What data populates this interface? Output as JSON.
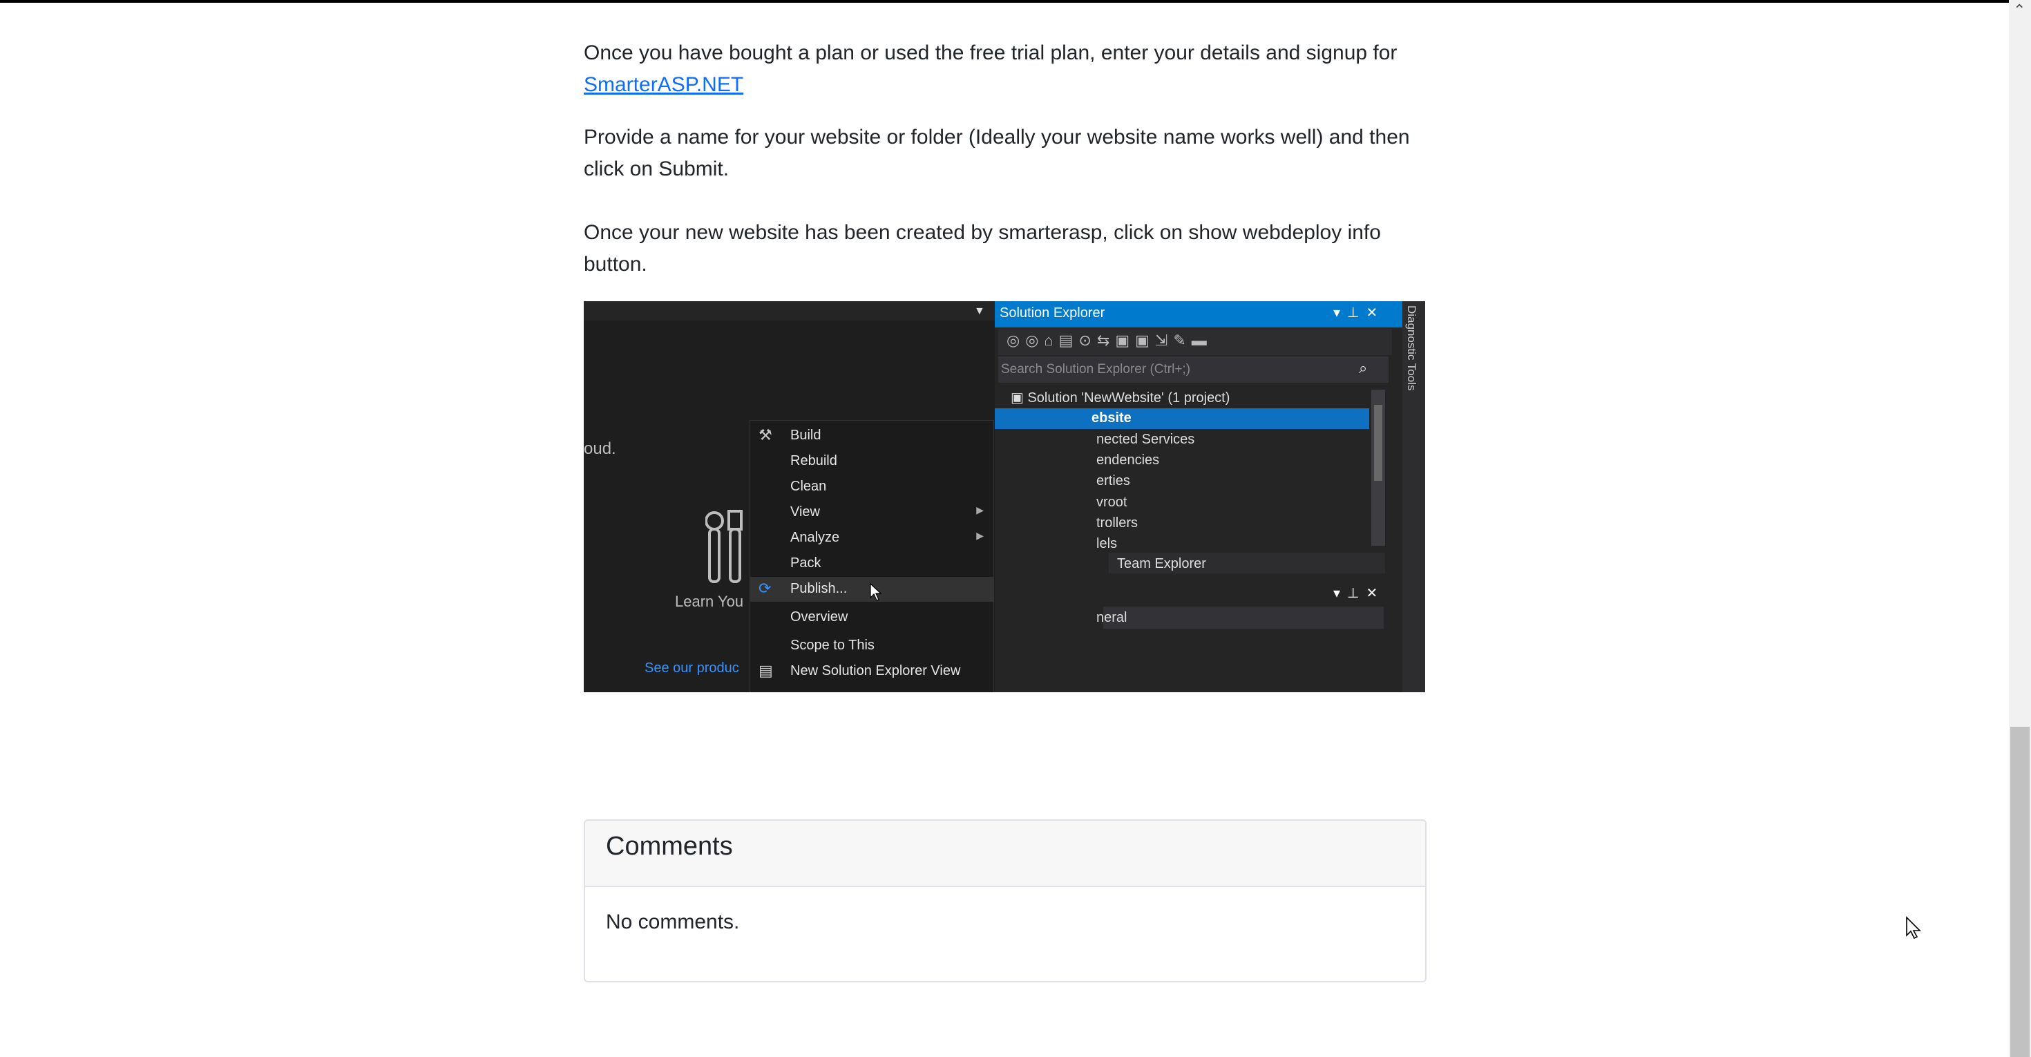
{
  "article": {
    "p1_text": "Once you have bought a plan or used the free trial plan, enter your details and signup for",
    "p1_link": "SmarterASP.NET",
    "p2": "Provide a name for your website or folder (Ideally your website name works well) and then click on Submit.",
    "p3": "Once your new website has been created by smarterasp, click on show webdeploy info button."
  },
  "vs_screenshot": {
    "cloud_fragment": "oud.",
    "learn_text": "Learn You",
    "see_link": "See our produc",
    "solution_explorer": {
      "title": "Solution Explorer",
      "search_placeholder": "Search Solution Explorer (Ctrl+;)",
      "solution_row": "Solution 'NewWebsite' (1 project)",
      "selected_item": "ebsite",
      "items": [
        "nected Services",
        "endencies",
        "erties",
        "vroot",
        "trollers",
        "lels"
      ],
      "team_explorer_tab": "Team Explorer",
      "general_dropdown": "neral"
    },
    "diagnostic_tools": "Diagnostic Tools",
    "context_menu": [
      {
        "label": "Build",
        "has_submenu": false,
        "icon": "build-icon"
      },
      {
        "label": "Rebuild",
        "has_submenu": false
      },
      {
        "label": "Clean",
        "has_submenu": false
      },
      {
        "label": "View",
        "has_submenu": true
      },
      {
        "label": "Analyze",
        "has_submenu": true
      },
      {
        "label": "Pack",
        "has_submenu": false
      },
      {
        "label": "Publish...",
        "has_submenu": false,
        "icon": "publish-icon",
        "highlighted": true
      },
      {
        "label": "Overview",
        "has_submenu": false
      },
      {
        "label": "Scope to This",
        "has_submenu": false
      },
      {
        "label": "New Solution Explorer View",
        "has_submenu": false,
        "icon": "new-view-icon"
      }
    ]
  },
  "comments": {
    "title": "Comments",
    "empty_text": "No comments."
  },
  "colors": {
    "link": "#0d6efd",
    "vs_accent": "#007acc",
    "card_border": "#dee2e6"
  }
}
